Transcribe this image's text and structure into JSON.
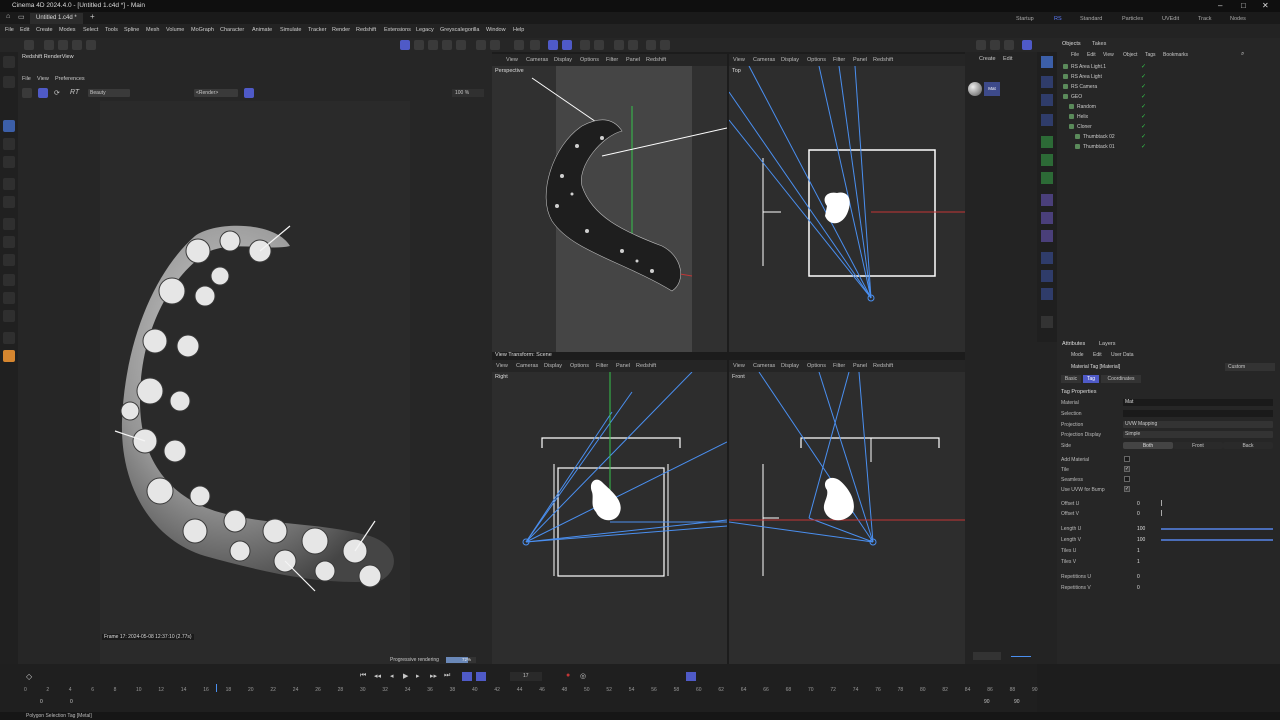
{
  "window": {
    "title": "Cinema 4D 2024.4.0 - [Untitled 1.c4d *] - Main"
  },
  "doc_tab": "Untitled 1.c4d *",
  "layouts": [
    "Startup",
    "RS",
    "Standard",
    "Particles",
    "UVEdit",
    "Track",
    "Nodes"
  ],
  "menus": [
    "File",
    "Edit",
    "Create",
    "Modes",
    "Select",
    "Tools",
    "Spline",
    "Mesh",
    "Volume",
    "MoGraph",
    "Character",
    "Animate",
    "Simulate",
    "Tracker",
    "Render",
    "Redshift",
    "Extensions",
    "Legacy",
    "Greyscalegorilla",
    "Window",
    "Help"
  ],
  "renderview": {
    "title": "Redshift RenderView",
    "menu": [
      "File",
      "View",
      "Preferences"
    ],
    "aov": "Beauty",
    "camera": "<Render>",
    "zoom": "100 %",
    "frame_info": "Frame  17:  2024-05-08  12:37:10  (2.77s)",
    "progress_label": "Progressive rendering",
    "progress_value": "72%",
    "progress_fraction": 0.72
  },
  "viewport": {
    "menu": [
      "View",
      "Cameras",
      "Display",
      "Options",
      "Filter",
      "Panel",
      "Redshift"
    ],
    "panes": [
      "Perspective",
      "Top",
      "Right",
      "Front"
    ],
    "view_transform": "View Transform: Scene"
  },
  "materials": {
    "menu": [
      "Create",
      "Edit"
    ],
    "mat_name": "Mat"
  },
  "objects": {
    "tabs": [
      "Objects",
      "Takes"
    ],
    "menu": [
      "File",
      "Edit",
      "View",
      "Object",
      "Tags",
      "Bookmarks"
    ],
    "items": [
      {
        "name": "RS Area Light.1",
        "indent": 0
      },
      {
        "name": "RS Area Light",
        "indent": 0
      },
      {
        "name": "RS Camera",
        "indent": 0
      },
      {
        "name": "GEO",
        "indent": 0
      },
      {
        "name": "Random",
        "indent": 1
      },
      {
        "name": "Helix",
        "indent": 1
      },
      {
        "name": "Cloner",
        "indent": 1
      },
      {
        "name": "Thumbtack 02",
        "indent": 2
      },
      {
        "name": "Thumbtack 01",
        "indent": 2
      }
    ]
  },
  "attributes": {
    "tabs": [
      "Attributes",
      "Layers"
    ],
    "menu": [
      "Mode",
      "Edit",
      "User Data"
    ],
    "object_title": "Material Tag [Material]",
    "preset": "Custom",
    "subtabs": [
      "Basic",
      "Tag",
      "Coordinates"
    ],
    "section": "Tag Properties",
    "material": {
      "label": "Material",
      "value": "Mat"
    },
    "selection": {
      "label": "Selection",
      "value": ""
    },
    "projection": {
      "label": "Projection",
      "value": "UVW Mapping"
    },
    "projection_display": {
      "label": "Projection Display",
      "value": "Simple"
    },
    "side": {
      "label": "Side",
      "options": [
        "Both",
        "Front",
        "Back"
      ]
    },
    "add_material": {
      "label": "Add Material",
      "checked": false
    },
    "tile": {
      "label": "Tile",
      "checked": true
    },
    "seamless": {
      "label": "Seamless",
      "checked": false
    },
    "use_uvw_bump": {
      "label": "Use UVW for Bump",
      "checked": true
    },
    "offset_u": {
      "label": "Offset U",
      "value": "0"
    },
    "offset_v": {
      "label": "Offset V",
      "value": "0"
    },
    "length_u": {
      "label": "Length U",
      "value": "100"
    },
    "length_v": {
      "label": "Length V",
      "value": "100"
    },
    "tiles_u": {
      "label": "Tiles U",
      "value": "1"
    },
    "tiles_v": {
      "label": "Tiles V",
      "value": "1"
    },
    "rep_u": {
      "label": "Repetitions U",
      "value": "0"
    },
    "rep_v": {
      "label": "Repetitions V",
      "value": "0"
    }
  },
  "timeline": {
    "current_frame": "17",
    "ticks": [
      "0",
      "2",
      "4",
      "6",
      "8",
      "10",
      "12",
      "14",
      "16",
      "18",
      "20",
      "22",
      "24",
      "26",
      "28",
      "30",
      "32",
      "34",
      "36",
      "38",
      "40",
      "42",
      "44",
      "46",
      "48",
      "50",
      "52",
      "54",
      "56",
      "58",
      "60",
      "62",
      "64",
      "66",
      "68",
      "70",
      "72",
      "74",
      "76",
      "78",
      "80",
      "82",
      "84",
      "86",
      "88",
      "90"
    ],
    "start": "0",
    "start2": "0",
    "end": "90",
    "end2": "90"
  },
  "status": "Polygon Selection Tag [Metal]",
  "colors": {
    "accent": "#5c7cff",
    "blue_toggle": "#4f5ac7",
    "orange": "#d6862f"
  }
}
